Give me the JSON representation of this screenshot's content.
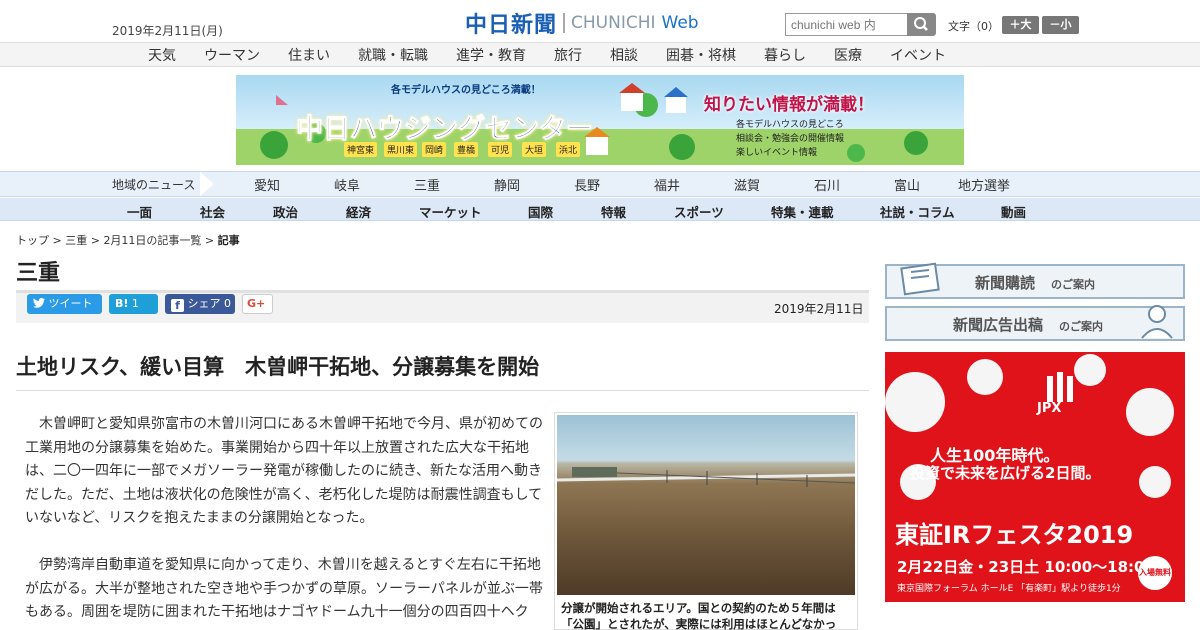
{
  "header": {
    "date": "2019年2月11日(月)",
    "logo_jp": "中日新聞",
    "logo_en": "CHUNICHI",
    "logo_web": "Web",
    "search_placeholder": "chunichi web 内",
    "font_size_label": "文字（0）",
    "font_bigger": "＋大",
    "font_smaller": "－小"
  },
  "categories": [
    "天気",
    "ウーマン",
    "住まい",
    "就職・転職",
    "進学・教育",
    "旅行",
    "相談",
    "囲碁・将棋",
    "暮らし",
    "医療",
    "イベント"
  ],
  "banner": {
    "sub": "各モデルハウスの見どころ満載！",
    "title": "中日ハウジングセンター",
    "right": "知りたい情報が満載！",
    "list": [
      "各モデルハウスの見どころ",
      "相談会・勉強会の開催情報",
      "楽しいイベント情報"
    ],
    "tags": [
      "神宮東",
      "黒川東",
      "岡崎",
      "豊橋",
      "可児",
      "大垣",
      "浜北"
    ]
  },
  "regions": {
    "label": "地域のニュース",
    "items": [
      "愛知",
      "岐阜",
      "三重",
      "静岡",
      "長野",
      "福井",
      "滋賀",
      "石川",
      "富山",
      "地方選挙"
    ]
  },
  "genres": [
    "一面",
    "社会",
    "政治",
    "経済",
    "マーケット",
    "国際",
    "特報",
    "スポーツ",
    "特集・連載",
    "社説・コラム",
    "動画"
  ],
  "breadcrumb": {
    "top": "トップ",
    "section": "三重",
    "list": "2月11日の記事一覧",
    "current": "記事"
  },
  "section_title": "三重",
  "share": {
    "tweet": "ツイート",
    "hatena_count": "1",
    "facebook": "シェア",
    "facebook_count": "0",
    "gplus": "G+"
  },
  "article": {
    "date": "2019年2月11日",
    "headline": "土地リスク、緩い目算　木曽岬干拓地、分譲募集を開始",
    "para1": "木曽岬町と愛知県弥富市の木曽川河口にある木曽岬干拓地で今月、県が初めての工業用地の分譲募集を始めた。事業開始から四十年以上放置された広大な干拓地は、二〇一四年に一部でメガソーラー発電が稼働したのに続き、新たな活用へ動きだした。ただ、土地は液状化の危険性が高く、老朽化した堤防は耐震性調査もしていないなど、リスクを抱えたままの分譲開始となった。",
    "para2": "伊勢湾岸自動車道を愛知県に向かって走り、木曽川を越えるとすぐ左右に干拓地が広がる。大半が整地された空き地や手つかずの草原。ソーラーパネルが並ぶ一帯もある。周囲を堤防に囲まれた干拓地はナゴヤドーム九十一個分の四百四十ヘク",
    "caption": "分譲が開始されるエリア。国との契約のため５年間は「公園」とされたが、実際には利用はほとんどなかっ"
  },
  "sidebar": {
    "subscribe": "新聞購読",
    "subscribe_small": "のご案内",
    "ad_publish": "新聞広告出稿",
    "ad_publish_small": "のご案内"
  },
  "ad": {
    "brand": "JPX",
    "line1": "人生100年時代。",
    "line2": "投資で未来を広げる2日間。",
    "title": "東証IRフェスタ2019",
    "date": "2月22日金・23日土 10:00～18:00",
    "venue": "東京国際フォーラム ホールE 「有楽町」駅より徒歩1分",
    "free": "入場無料"
  },
  "colors": {
    "logo_blue": "#1a5fb4",
    "region_bar": "#e8f0fa",
    "genre_bar": "#dce8f6",
    "twitter": "#2b9be8",
    "hatena": "#1e9fd8",
    "facebook": "#3b5998",
    "ad_red": "#e0131a"
  }
}
